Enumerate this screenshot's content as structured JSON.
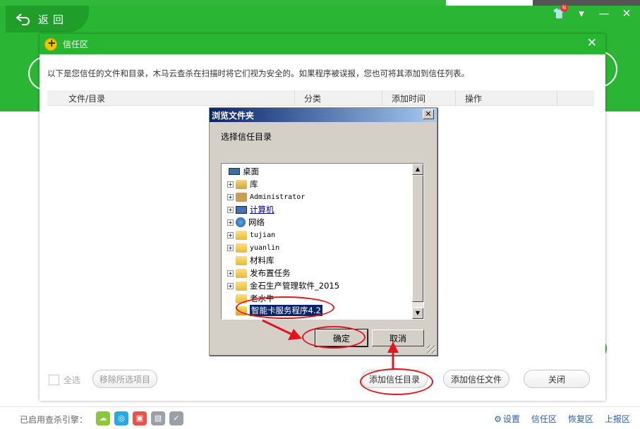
{
  "app": {
    "back_label": "返回",
    "window_controls": {
      "badge": "N"
    }
  },
  "trust_dialog": {
    "title": "信任区",
    "description": "以下是您信任的文件和目录，木马云查杀在扫描时将它们视为安全的。如果程序被误报，您也可将其添加到信任列表。",
    "columns": [
      "文件/目录",
      "分类",
      "添加时间",
      "操作"
    ],
    "select_all_label": "全选",
    "remove_selected_label": "移除所选项目",
    "add_dir_label": "添加信任目录",
    "add_file_label": "添加信任文件",
    "close_label": "关闭"
  },
  "browse_dialog": {
    "title": "浏览文件夹",
    "prompt": "选择信任目录",
    "tree": [
      {
        "label": "桌面",
        "icon": "desktop-icon"
      },
      {
        "label": "库",
        "icon": "library-icon"
      },
      {
        "label": "Administrator",
        "icon": "user-folder-icon"
      },
      {
        "label": "计算机",
        "icon": "computer-icon"
      },
      {
        "label": "网络",
        "icon": "network-icon"
      },
      {
        "label": "tujian",
        "icon": "folder-icon"
      },
      {
        "label": "yuanlin",
        "icon": "folder-icon"
      },
      {
        "label": "材料库",
        "icon": "folder-icon"
      },
      {
        "label": "发布置任务",
        "icon": "folder-icon"
      },
      {
        "label": "金石生产管理软件_2015",
        "icon": "folder-icon"
      },
      {
        "label": "老水牛",
        "icon": "folder-icon"
      },
      {
        "label": "智能卡服务程序4.2",
        "icon": "folder-icon",
        "selected": true
      }
    ],
    "ok_label": "确定",
    "cancel_label": "取消"
  },
  "statusbar": {
    "engines_label": "已启用查杀引擎：",
    "engines": [
      {
        "icon": "cloud-engine-icon",
        "color": "#8cc63f"
      },
      {
        "icon": "qvm-engine-icon",
        "color": "#29a9e1"
      },
      {
        "icon": "repair-engine-icon",
        "color": "#e8534a"
      },
      {
        "icon": "system-engine-icon",
        "color": "#9aa0a6"
      },
      {
        "icon": "avira-engine-icon",
        "color": "#9aa0a6"
      }
    ],
    "settings_label": "设置",
    "trust_zone_label": "信任区",
    "restore_zone_label": "恢复区",
    "report_zone_label": "上报区"
  },
  "colors": {
    "brand_green": "#2bb534",
    "annotation_red": "#e2161c"
  }
}
